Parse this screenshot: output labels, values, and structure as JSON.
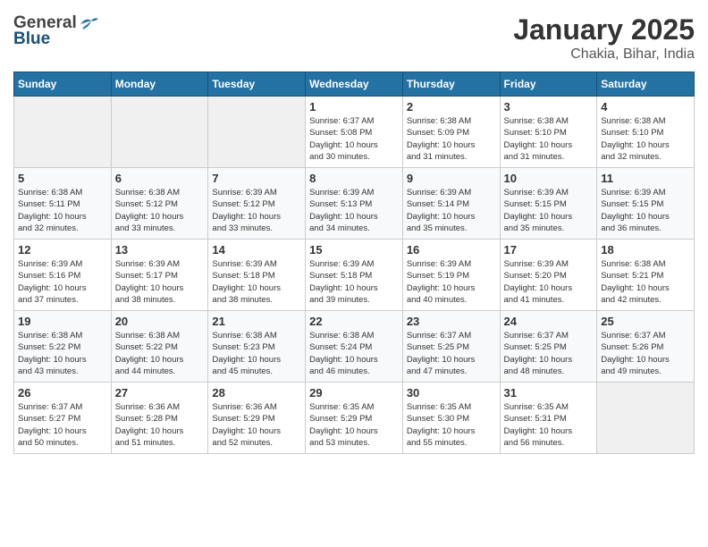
{
  "header": {
    "logo_general": "General",
    "logo_blue": "Blue",
    "title": "January 2025",
    "subtitle": "Chakia, Bihar, India"
  },
  "weekdays": [
    "Sunday",
    "Monday",
    "Tuesday",
    "Wednesday",
    "Thursday",
    "Friday",
    "Saturday"
  ],
  "weeks": [
    [
      {
        "day": "",
        "info": ""
      },
      {
        "day": "",
        "info": ""
      },
      {
        "day": "",
        "info": ""
      },
      {
        "day": "1",
        "info": "Sunrise: 6:37 AM\nSunset: 5:08 PM\nDaylight: 10 hours\nand 30 minutes."
      },
      {
        "day": "2",
        "info": "Sunrise: 6:38 AM\nSunset: 5:09 PM\nDaylight: 10 hours\nand 31 minutes."
      },
      {
        "day": "3",
        "info": "Sunrise: 6:38 AM\nSunset: 5:10 PM\nDaylight: 10 hours\nand 31 minutes."
      },
      {
        "day": "4",
        "info": "Sunrise: 6:38 AM\nSunset: 5:10 PM\nDaylight: 10 hours\nand 32 minutes."
      }
    ],
    [
      {
        "day": "5",
        "info": "Sunrise: 6:38 AM\nSunset: 5:11 PM\nDaylight: 10 hours\nand 32 minutes."
      },
      {
        "day": "6",
        "info": "Sunrise: 6:38 AM\nSunset: 5:12 PM\nDaylight: 10 hours\nand 33 minutes."
      },
      {
        "day": "7",
        "info": "Sunrise: 6:39 AM\nSunset: 5:12 PM\nDaylight: 10 hours\nand 33 minutes."
      },
      {
        "day": "8",
        "info": "Sunrise: 6:39 AM\nSunset: 5:13 PM\nDaylight: 10 hours\nand 34 minutes."
      },
      {
        "day": "9",
        "info": "Sunrise: 6:39 AM\nSunset: 5:14 PM\nDaylight: 10 hours\nand 35 minutes."
      },
      {
        "day": "10",
        "info": "Sunrise: 6:39 AM\nSunset: 5:15 PM\nDaylight: 10 hours\nand 35 minutes."
      },
      {
        "day": "11",
        "info": "Sunrise: 6:39 AM\nSunset: 5:15 PM\nDaylight: 10 hours\nand 36 minutes."
      }
    ],
    [
      {
        "day": "12",
        "info": "Sunrise: 6:39 AM\nSunset: 5:16 PM\nDaylight: 10 hours\nand 37 minutes."
      },
      {
        "day": "13",
        "info": "Sunrise: 6:39 AM\nSunset: 5:17 PM\nDaylight: 10 hours\nand 38 minutes."
      },
      {
        "day": "14",
        "info": "Sunrise: 6:39 AM\nSunset: 5:18 PM\nDaylight: 10 hours\nand 38 minutes."
      },
      {
        "day": "15",
        "info": "Sunrise: 6:39 AM\nSunset: 5:18 PM\nDaylight: 10 hours\nand 39 minutes."
      },
      {
        "day": "16",
        "info": "Sunrise: 6:39 AM\nSunset: 5:19 PM\nDaylight: 10 hours\nand 40 minutes."
      },
      {
        "day": "17",
        "info": "Sunrise: 6:39 AM\nSunset: 5:20 PM\nDaylight: 10 hours\nand 41 minutes."
      },
      {
        "day": "18",
        "info": "Sunrise: 6:38 AM\nSunset: 5:21 PM\nDaylight: 10 hours\nand 42 minutes."
      }
    ],
    [
      {
        "day": "19",
        "info": "Sunrise: 6:38 AM\nSunset: 5:22 PM\nDaylight: 10 hours\nand 43 minutes."
      },
      {
        "day": "20",
        "info": "Sunrise: 6:38 AM\nSunset: 5:22 PM\nDaylight: 10 hours\nand 44 minutes."
      },
      {
        "day": "21",
        "info": "Sunrise: 6:38 AM\nSunset: 5:23 PM\nDaylight: 10 hours\nand 45 minutes."
      },
      {
        "day": "22",
        "info": "Sunrise: 6:38 AM\nSunset: 5:24 PM\nDaylight: 10 hours\nand 46 minutes."
      },
      {
        "day": "23",
        "info": "Sunrise: 6:37 AM\nSunset: 5:25 PM\nDaylight: 10 hours\nand 47 minutes."
      },
      {
        "day": "24",
        "info": "Sunrise: 6:37 AM\nSunset: 5:25 PM\nDaylight: 10 hours\nand 48 minutes."
      },
      {
        "day": "25",
        "info": "Sunrise: 6:37 AM\nSunset: 5:26 PM\nDaylight: 10 hours\nand 49 minutes."
      }
    ],
    [
      {
        "day": "26",
        "info": "Sunrise: 6:37 AM\nSunset: 5:27 PM\nDaylight: 10 hours\nand 50 minutes."
      },
      {
        "day": "27",
        "info": "Sunrise: 6:36 AM\nSunset: 5:28 PM\nDaylight: 10 hours\nand 51 minutes."
      },
      {
        "day": "28",
        "info": "Sunrise: 6:36 AM\nSunset: 5:29 PM\nDaylight: 10 hours\nand 52 minutes."
      },
      {
        "day": "29",
        "info": "Sunrise: 6:35 AM\nSunset: 5:29 PM\nDaylight: 10 hours\nand 53 minutes."
      },
      {
        "day": "30",
        "info": "Sunrise: 6:35 AM\nSunset: 5:30 PM\nDaylight: 10 hours\nand 55 minutes."
      },
      {
        "day": "31",
        "info": "Sunrise: 6:35 AM\nSunset: 5:31 PM\nDaylight: 10 hours\nand 56 minutes."
      },
      {
        "day": "",
        "info": ""
      }
    ]
  ]
}
